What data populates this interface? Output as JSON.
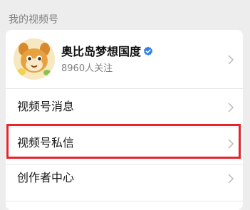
{
  "section": {
    "title": "我的视频号"
  },
  "profile": {
    "name": "奥比岛梦想国度",
    "followers": "8960人关注",
    "avatar_icon": "mascot-avatar-icon",
    "verified_icon": "verified-badge-icon"
  },
  "menu": [
    {
      "label": "视频号消息"
    },
    {
      "label": "视频号私信"
    },
    {
      "label": "创作者中心"
    }
  ],
  "colors": {
    "background": "#ededed",
    "card": "#ffffff",
    "highlight": "#e8242b",
    "verified": "#2f7ee8",
    "secondary_text": "#7f7f7f"
  }
}
